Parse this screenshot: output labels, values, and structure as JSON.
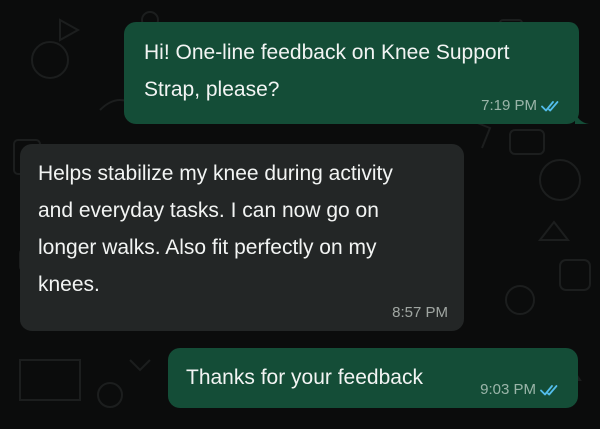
{
  "conversation": {
    "messages": [
      {
        "direction": "outgoing",
        "text": "Hi! One-line feedback on Knee Support\nStrap, please?",
        "time": "7:19 PM",
        "status_icon": "double-check-read-icon"
      },
      {
        "direction": "incoming",
        "text": "Helps stabilize my knee during activity\nand everyday tasks. I can now go on\nlonger walks. Also fit perfectly on my\nknees.",
        "time": "8:57 PM"
      },
      {
        "direction": "outgoing",
        "text": "Thanks for your feedback",
        "time": "9:03 PM",
        "status_icon": "double-check-read-icon"
      }
    ]
  },
  "colors": {
    "background": "#0b0c0c",
    "outgoing_bubble": "#144d37",
    "incoming_bubble": "#232626",
    "read_tick": "#53bdeb",
    "text": "#f2f4f3"
  }
}
